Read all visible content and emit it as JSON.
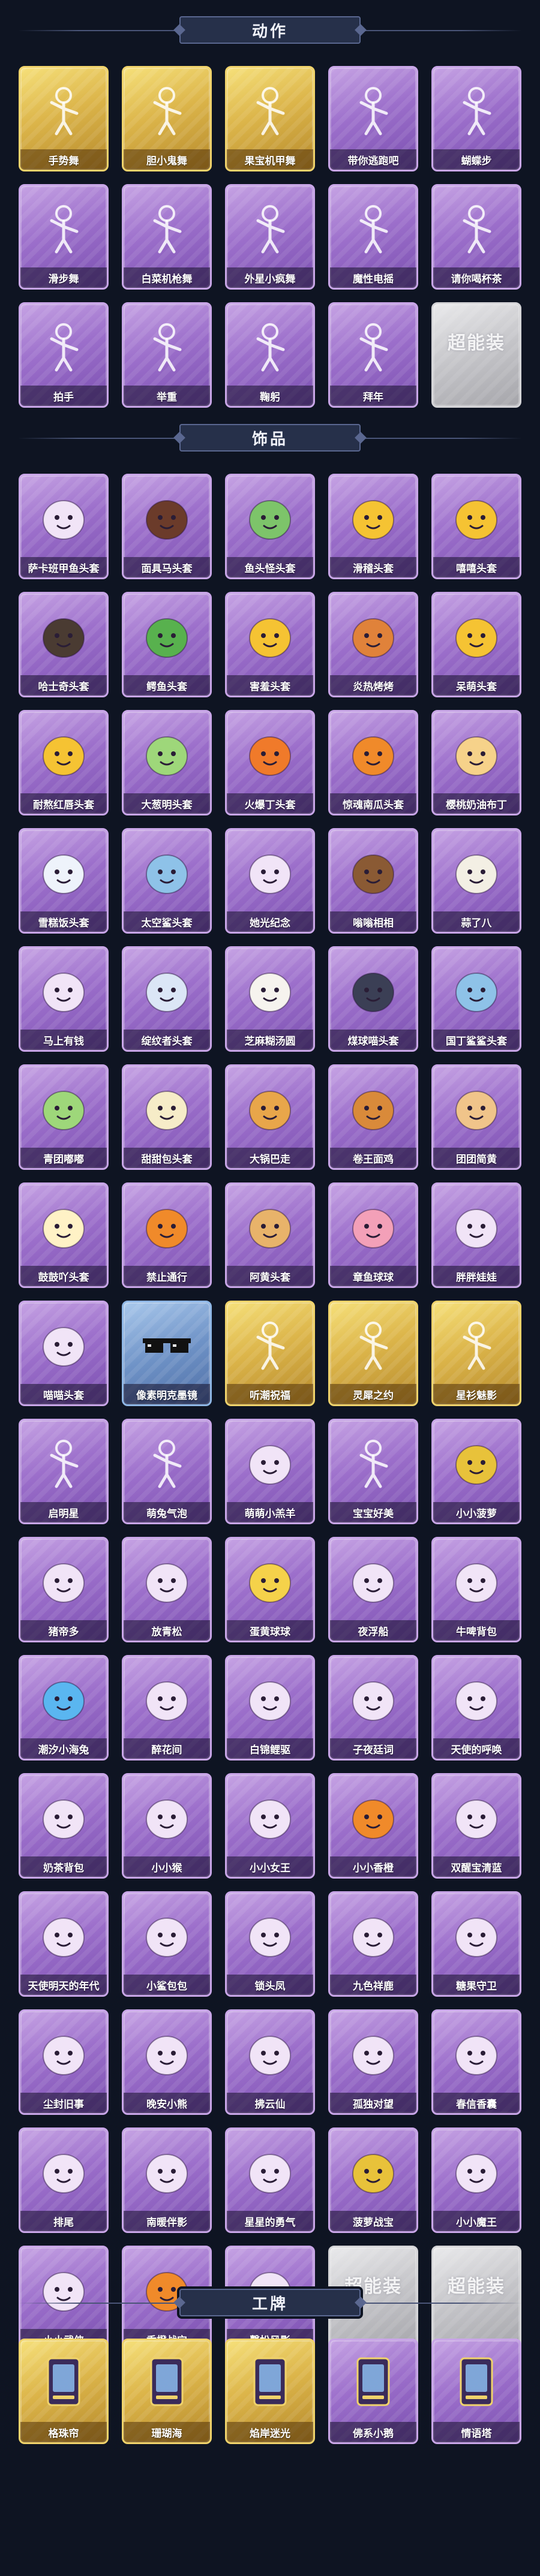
{
  "sections": [
    {
      "title": "动作",
      "items": [
        {
          "label": "手势舞",
          "icon": "dance-figure-icon",
          "tier": "gold"
        },
        {
          "label": "胆小鬼舞",
          "icon": "dance-figure-icon",
          "tier": "gold"
        },
        {
          "label": "果宝机甲舞",
          "icon": "dance-figure-icon",
          "tier": "gold"
        },
        {
          "label": "带你逃跑吧",
          "icon": "dance-figure-icon",
          "tier": "purple"
        },
        {
          "label": "蝴蝶步",
          "icon": "dance-figure-icon",
          "tier": "purple"
        },
        {
          "label": "滑步舞",
          "icon": "dance-figure-icon",
          "tier": "purple"
        },
        {
          "label": "白菜机枪舞",
          "icon": "dance-figure-icon",
          "tier": "purple"
        },
        {
          "label": "外星小疯舞",
          "icon": "dance-figure-icon",
          "tier": "purple"
        },
        {
          "label": "魔性电摇",
          "icon": "dance-figure-icon",
          "tier": "purple"
        },
        {
          "label": "请你喝杯茶",
          "icon": "dance-figure-icon",
          "tier": "purple"
        },
        {
          "label": "拍手",
          "icon": "figure-icon",
          "tier": "purple"
        },
        {
          "label": "举重",
          "icon": "figure-icon",
          "tier": "purple"
        },
        {
          "label": "鞠躬",
          "icon": "figure-icon",
          "tier": "purple"
        },
        {
          "label": "拜年",
          "icon": "figure-icon",
          "tier": "purple"
        },
        {
          "label": "",
          "icon": "brand-placeholder-icon",
          "tier": "silver",
          "brand": "超能装"
        }
      ]
    },
    {
      "title": "饰品",
      "items": [
        {
          "label": "萨卡班甲鱼头套",
          "icon": "fish-head-icon",
          "tier": "purple"
        },
        {
          "label": "面具马头套",
          "icon": "horse-head-icon",
          "tier": "purple"
        },
        {
          "label": "鱼头怪头套",
          "icon": "fish-monster-head-icon",
          "tier": "purple"
        },
        {
          "label": "滑稽头套",
          "icon": "smiley-head-icon",
          "tier": "purple"
        },
        {
          "label": "嘻嘻头套",
          "icon": "grin-head-icon",
          "tier": "purple"
        },
        {
          "label": "哈士奇头套",
          "icon": "dog-head-icon",
          "tier": "purple"
        },
        {
          "label": "鳄鱼头套",
          "icon": "crocodile-head-icon",
          "tier": "purple"
        },
        {
          "label": "害羞头套",
          "icon": "shy-face-head-icon",
          "tier": "purple"
        },
        {
          "label": "炎热烤烤",
          "icon": "angry-face-head-icon",
          "tier": "purple"
        },
        {
          "label": "呆萌头套",
          "icon": "face-head-icon",
          "tier": "purple"
        },
        {
          "label": "耐熬红唇头套",
          "icon": "sun-head-icon",
          "tier": "purple"
        },
        {
          "label": "大葱明头套",
          "icon": "scallion-head-icon",
          "tier": "purple"
        },
        {
          "label": "火爆丁头套",
          "icon": "flame-head-icon",
          "tier": "purple"
        },
        {
          "label": "惊魂南瓜头套",
          "icon": "pumpkin-head-icon",
          "tier": "purple"
        },
        {
          "label": "樱桃奶油布丁",
          "icon": "pudding-head-icon",
          "tier": "purple"
        },
        {
          "label": "雪糕饭头套",
          "icon": "snowman-head-icon",
          "tier": "purple"
        },
        {
          "label": "太空鲨头套",
          "icon": "shark-head-icon",
          "tier": "purple"
        },
        {
          "label": "她光纪念",
          "icon": "candle-head-icon",
          "tier": "purple"
        },
        {
          "label": "嗡嗡相相",
          "icon": "dog-ears-head-icon",
          "tier": "purple"
        },
        {
          "label": "蒜了八",
          "icon": "garlic-head-icon",
          "tier": "purple"
        },
        {
          "label": "马上有钱",
          "icon": "bird-head-icon",
          "tier": "purple"
        },
        {
          "label": "绽纹者头套",
          "icon": "cloud-head-icon",
          "tier": "purple"
        },
        {
          "label": "芝麻糊汤圆",
          "icon": "dumpling-head-icon",
          "tier": "purple"
        },
        {
          "label": "煤球喵头套",
          "icon": "cat-head-icon",
          "tier": "purple"
        },
        {
          "label": "国丁鲨鲨头套",
          "icon": "shark-head-icon",
          "tier": "purple"
        },
        {
          "label": "青团嘟嘟",
          "icon": "green-bun-head-icon",
          "tier": "purple"
        },
        {
          "label": "甜甜包头套",
          "icon": "bun-crown-head-icon",
          "tier": "purple"
        },
        {
          "label": "大锅巴走",
          "icon": "cookie-head-icon",
          "tier": "purple"
        },
        {
          "label": "卷王面鸡",
          "icon": "bread-head-icon",
          "tier": "purple"
        },
        {
          "label": "团团简黄",
          "icon": "hamster-head-icon",
          "tier": "purple"
        },
        {
          "label": "鼓鼓吖头套",
          "icon": "chick-head-icon",
          "tier": "purple"
        },
        {
          "label": "禁止通行",
          "icon": "cone-head-icon",
          "tier": "purple"
        },
        {
          "label": "阿黄头套",
          "icon": "doge-head-icon",
          "tier": "purple"
        },
        {
          "label": "章鱼球球",
          "icon": "octopus-head-icon",
          "tier": "purple"
        },
        {
          "label": "胖胖娃娃",
          "icon": "doll-head-icon",
          "tier": "purple"
        },
        {
          "label": "喵喵头套",
          "icon": "tabby-cat-head-icon",
          "tier": "purple"
        },
        {
          "label": "像素明克墨镜",
          "icon": "pixel-sunglasses-icon",
          "tier": "blue"
        },
        {
          "label": "听潮祝福",
          "icon": "figure-icon",
          "tier": "gold"
        },
        {
          "label": "灵犀之约",
          "icon": "figure-icon",
          "tier": "gold"
        },
        {
          "label": "星衫魅影",
          "icon": "figure-icon",
          "tier": "gold"
        },
        {
          "label": "启明星",
          "icon": "figure-icon",
          "tier": "purple"
        },
        {
          "label": "萌兔气泡",
          "icon": "figure-icon",
          "tier": "purple"
        },
        {
          "label": "萌萌小羔羊",
          "icon": "lamb-icon",
          "tier": "purple"
        },
        {
          "label": "宝宝好美",
          "icon": "figure-icon",
          "tier": "purple"
        },
        {
          "label": "小小菠萝",
          "icon": "pineapple-icon",
          "tier": "purple"
        },
        {
          "label": "猪帝多",
          "icon": "chibi-figure-icon",
          "tier": "purple"
        },
        {
          "label": "放青松",
          "icon": "bonsai-icon",
          "tier": "purple"
        },
        {
          "label": "蛋黄球球",
          "icon": "chick-icon",
          "tier": "purple"
        },
        {
          "label": "夜浮船",
          "icon": "crystal-icon",
          "tier": "purple"
        },
        {
          "label": "牛啤背包",
          "icon": "cake-icon",
          "tier": "purple"
        },
        {
          "label": "潮汐小海兔",
          "icon": "blue-cat-icon",
          "tier": "purple"
        },
        {
          "label": "醉花间",
          "icon": "lantern-icon",
          "tier": "purple"
        },
        {
          "label": "白锦鲤驱",
          "icon": "koi-icon",
          "tier": "purple"
        },
        {
          "label": "子夜廷词",
          "icon": "fairy-figure-icon",
          "tier": "purple"
        },
        {
          "label": "天使的呼唤",
          "icon": "angel-figure-icon",
          "tier": "purple"
        },
        {
          "label": "奶茶背包",
          "icon": "milk-tea-icon",
          "tier": "purple"
        },
        {
          "label": "小小猴",
          "icon": "monkey-icon",
          "tier": "purple"
        },
        {
          "label": "小小女王",
          "icon": "queen-figure-icon",
          "tier": "purple"
        },
        {
          "label": "小小香橙",
          "icon": "orange-icon",
          "tier": "purple"
        },
        {
          "label": "双醒宝清蓝",
          "icon": "ribbon-orb-icon",
          "tier": "purple"
        },
        {
          "label": "天使明天的年代",
          "icon": "tree-girl-icon",
          "tier": "purple"
        },
        {
          "label": "小鲨包包",
          "icon": "shark-plush-icon",
          "tier": "purple"
        },
        {
          "label": "锁头凤",
          "icon": "phoenix-figure-icon",
          "tier": "purple"
        },
        {
          "label": "九色祥鹿",
          "icon": "deer-icon",
          "tier": "purple"
        },
        {
          "label": "糖果守卫",
          "icon": "lantern-charm-icon",
          "tier": "purple"
        },
        {
          "label": "尘封旧事",
          "icon": "boy-figure-icon",
          "tier": "purple"
        },
        {
          "label": "晚安小熊",
          "icon": "bear-charm-icon",
          "tier": "purple"
        },
        {
          "label": "拂云仙",
          "icon": "immortal-figure-icon",
          "tier": "purple"
        },
        {
          "label": "孤独对望",
          "icon": "lantern-charm-icon",
          "tier": "purple"
        },
        {
          "label": "春信香囊",
          "icon": "sachet-icon",
          "tier": "purple"
        },
        {
          "label": "排尾",
          "icon": "fox-figure-icon",
          "tier": "purple"
        },
        {
          "label": "南暖伴影",
          "icon": "dancer-figure-icon",
          "tier": "purple"
        },
        {
          "label": "星星的勇气",
          "icon": "star-girl-icon",
          "tier": "purple"
        },
        {
          "label": "菠萝战宝",
          "icon": "pineapple-bot-icon",
          "tier": "purple"
        },
        {
          "label": "小小魔王",
          "icon": "demon-figure-icon",
          "tier": "purple"
        },
        {
          "label": "小小武侠",
          "icon": "chibi-knight-icon",
          "tier": "purple"
        },
        {
          "label": "香橙战宝",
          "icon": "orange-bot-icon",
          "tier": "purple"
        },
        {
          "label": "馨松风影",
          "icon": "sun-ornament-icon",
          "tier": "purple"
        },
        {
          "label": "",
          "icon": "brand-placeholder-icon",
          "tier": "silver",
          "brand": "超能装"
        },
        {
          "label": "",
          "icon": "brand-placeholder-icon",
          "tier": "silver",
          "brand": "超能装"
        }
      ]
    },
    {
      "title": "工牌",
      "items": [
        {
          "label": "格珠帘",
          "icon": "card-badge-icon",
          "tier": "gold"
        },
        {
          "label": "珊瑚海",
          "icon": "card-badge-icon",
          "tier": "gold"
        },
        {
          "label": "焰岸迷光",
          "icon": "card-badge-icon",
          "tier": "gold"
        },
        {
          "label": "佛系小鹅",
          "icon": "card-badge-icon",
          "tier": "purple"
        },
        {
          "label": "情语塔",
          "icon": "card-badge-icon",
          "tier": "purple"
        }
      ]
    }
  ],
  "colors": {
    "background": "#0e1422",
    "purple_tier": "#9c6fcb",
    "gold_tier": "#dcb54a",
    "silver_tier": "#c4c4c8",
    "blue_tier": "#6f93c7"
  }
}
